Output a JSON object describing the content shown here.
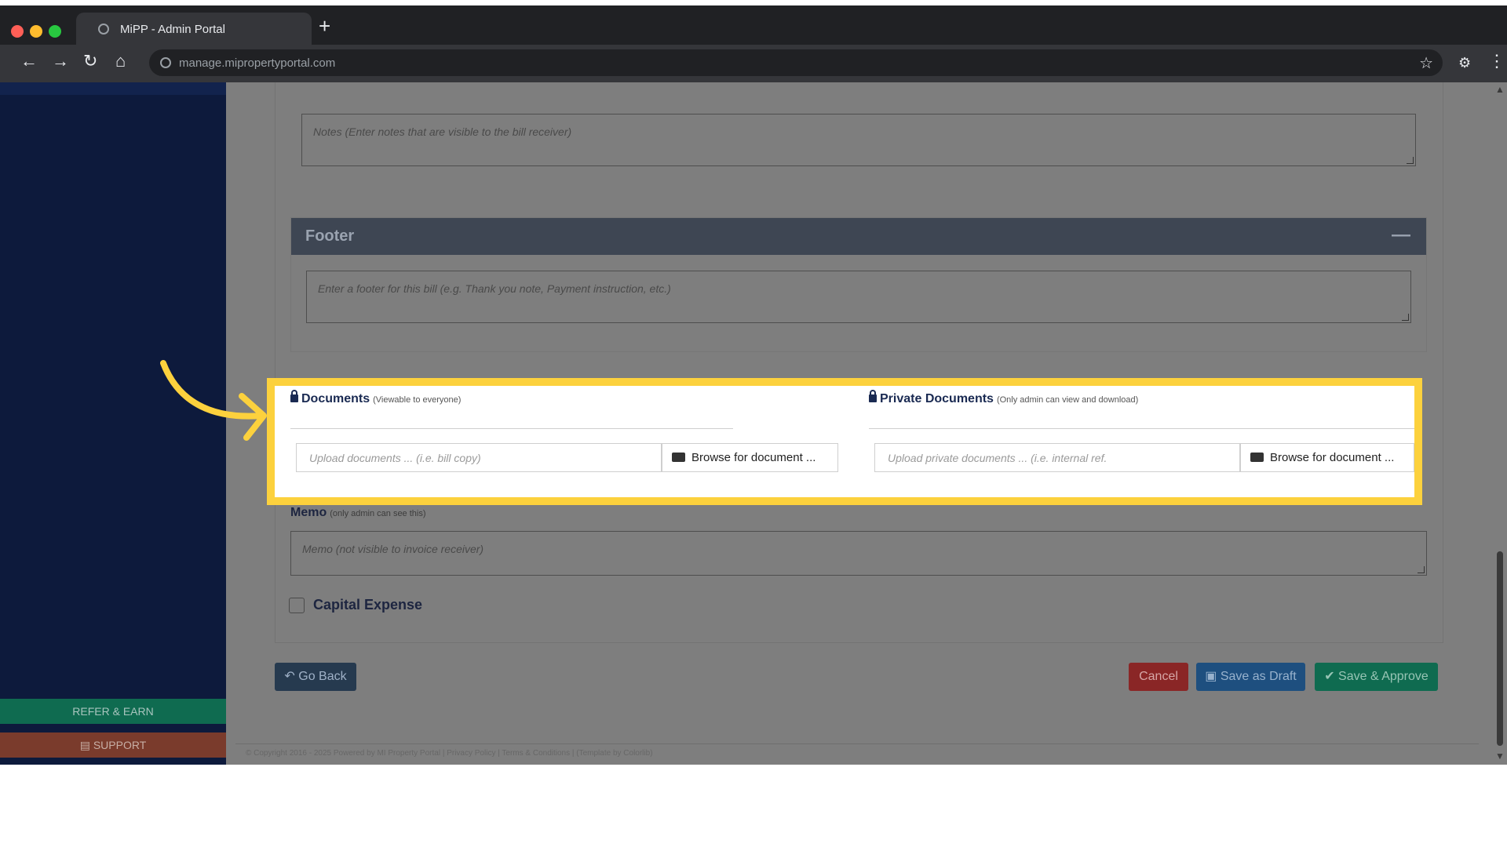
{
  "browser": {
    "tab_title": "MiPP - Admin Portal",
    "new_tab": "+",
    "url": "manage.mipropertyportal.com"
  },
  "sidebar": {
    "refer_label": "REFER & EARN",
    "support_label": "SUPPORT"
  },
  "form": {
    "notes_placeholder": "Notes (Enter notes that are visible to the bill receiver)",
    "footer_title": "Footer",
    "footer_placeholder": "Enter a footer for this bill (e.g. Thank you note, Payment instruction, etc.)",
    "documents": {
      "title": "Documents",
      "subtitle": "(Viewable to everyone)",
      "upload_placeholder": "Upload documents ... (i.e. bill copy)",
      "browse_label": "Browse for document ..."
    },
    "private_documents": {
      "title": "Private Documents",
      "subtitle": "(Only admin can view and download)",
      "upload_placeholder": "Upload private documents ... (i.e. internal ref.",
      "browse_label": "Browse for document ..."
    },
    "memo": {
      "label": "Memo",
      "sublabel": "(only admin can see this)",
      "placeholder": "Memo (not visible to invoice receiver)"
    },
    "capital_expense_label": "Capital Expense",
    "capital_expense_checked": false
  },
  "actions": {
    "go_back": "Go Back",
    "cancel": "Cancel",
    "save_draft": "Save as Draft",
    "save_approve": "Save & Approve"
  },
  "footer": {
    "copyright": "© Copyright 2016 - 2025 Powered by MI Property Portal | Privacy Policy | Terms & Conditions | (Template by Colorlib)"
  },
  "colors": {
    "highlight": "#fcd13d",
    "sidebar": "#0d1a3c",
    "overlay": "#7e7e7e"
  }
}
